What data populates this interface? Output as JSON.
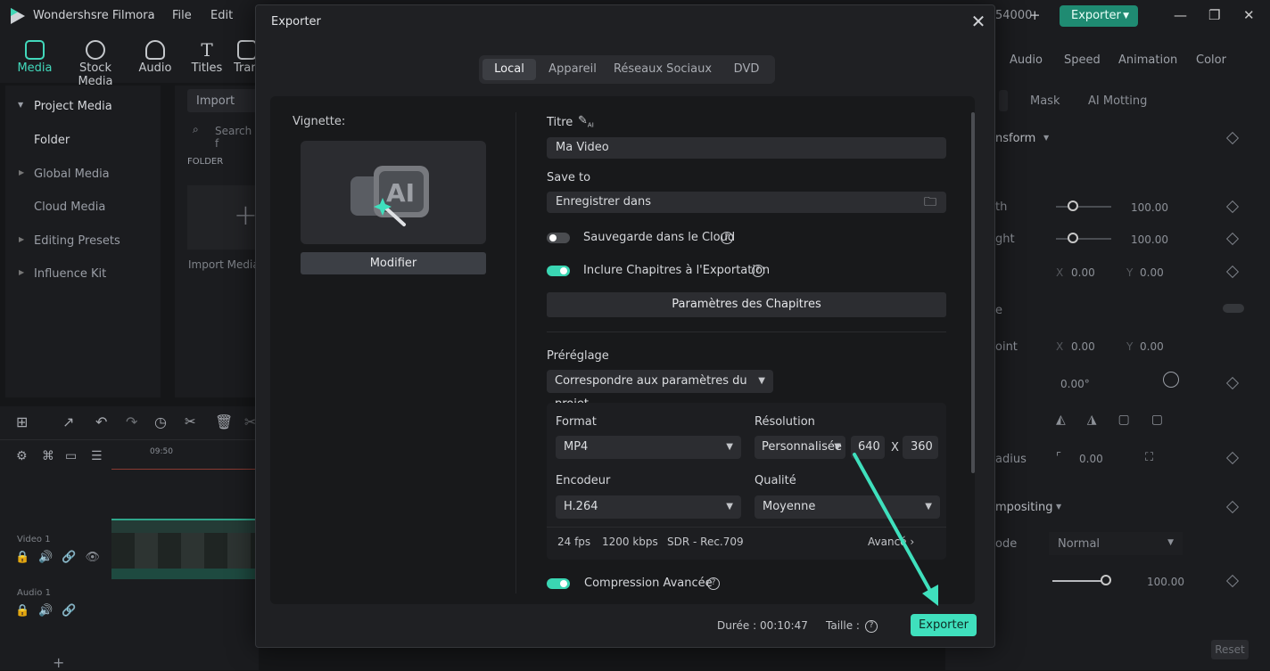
{
  "app": {
    "title": "Wondershsre Filmora",
    "counter": "54000"
  },
  "menu": [
    "File",
    "Edit"
  ],
  "header": {
    "export_label": "Exporter"
  },
  "tooltabs": [
    "Media",
    "Stock Media",
    "Audio",
    "Titles",
    "Tran"
  ],
  "leftnav": {
    "items": [
      "Project Media",
      "Folder",
      "Global Media",
      "Cloud Media",
      "Editing Presets",
      "Influence Kit"
    ]
  },
  "media": {
    "import_label": "Import",
    "search_placeholder": "Search f",
    "folder_header": "FOLDER",
    "import_media": "Import Media"
  },
  "timeline": {
    "time_mark": "09:50",
    "video_track": "Video 1",
    "audio_track": "Audio 1"
  },
  "rightpanel": {
    "tabs": [
      "Audio",
      "Speed",
      "Animation",
      "Color"
    ],
    "subtabs": [
      "Mask",
      "AI Motting"
    ],
    "section_transform": "nsform",
    "width_label": "th",
    "width_val": "100.00",
    "height_label": "ght",
    "height_val": "100.00",
    "pos_x": "0.00",
    "pos_y": "0.00",
    "section_e": "e",
    "point_label": "oint",
    "point_x": "0.00",
    "point_y": "0.00",
    "rotate_val": "0.00°",
    "radius_label": "adius",
    "radius_val": "0.00",
    "compositing": "mpositing",
    "mode_label": "ode",
    "mode_val": "Normal",
    "opacity_val": "100.00",
    "reset": "Reset",
    "axis_x": "X",
    "axis_y": "Y"
  },
  "modal": {
    "title": "Exporter",
    "tabs": [
      "Local",
      "Appareil",
      "Réseaux Sociaux",
      "DVD"
    ],
    "active_tab": 0,
    "vignette_label": "Vignette:",
    "modify_label": "Modifier",
    "title_label": "Titre",
    "title_value": "Ma Video",
    "save_to_label": "Save to",
    "save_to_value": "Enregistrer dans",
    "cloud_backup": {
      "label": "Sauvegarde dans le Cloud",
      "on": false
    },
    "include_chapters": {
      "label": "Inclure Chapitres à l'Exportation",
      "on": true
    },
    "chapter_settings": "Paramètres des Chapitres",
    "preset_label": "Préréglage",
    "preset_value": "Correspondre aux paramètres du projet",
    "format_label": "Format",
    "format_value": "MP4",
    "resolution_label": "Résolution",
    "resolution_value": "Personnalisée",
    "res_w": "640",
    "res_x": "X",
    "res_h": "360",
    "encoder_label": "Encodeur",
    "encoder_value": "H.264",
    "quality_label": "Qualité",
    "quality_value": "Moyenne",
    "fps": "24 fps",
    "bitrate": "1200 kbps",
    "color": "SDR - Rec.709",
    "advanced": "Avancé",
    "compression": {
      "label": "Compression Avancée",
      "on": true
    },
    "duration": "Durée : 00:10:47",
    "size": "Taille :",
    "export_label": "Exporter"
  },
  "colors": {
    "accent": "#3fe0bd",
    "brand_green": "#1f8b72"
  }
}
